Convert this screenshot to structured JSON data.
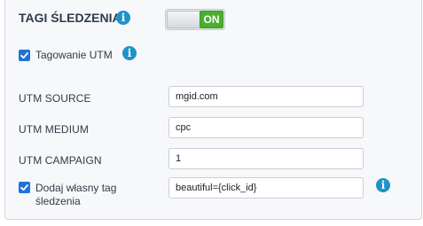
{
  "section": {
    "title": "TAGI ŚLEDZENIA",
    "toggle_label": "ON"
  },
  "utm_tagging": {
    "label": "Tagowanie UTM",
    "checked": true
  },
  "fields": {
    "source": {
      "label": "UTM SOURCE",
      "value": "mgid.com"
    },
    "medium": {
      "label": "UTM MEDIUM",
      "value": "cpc"
    },
    "campaign": {
      "label": "UTM CAMPAIGN",
      "value": "1"
    }
  },
  "custom_tag": {
    "label_line1": "Dodaj własny tag",
    "label_line2": "śledzenia",
    "value": "beautiful={click_id}",
    "checked": true
  },
  "icons": {
    "info": "i"
  },
  "colors": {
    "accent": "#1e73d8",
    "info": "#1f93c9",
    "toggle_on": "#4aae2e"
  }
}
